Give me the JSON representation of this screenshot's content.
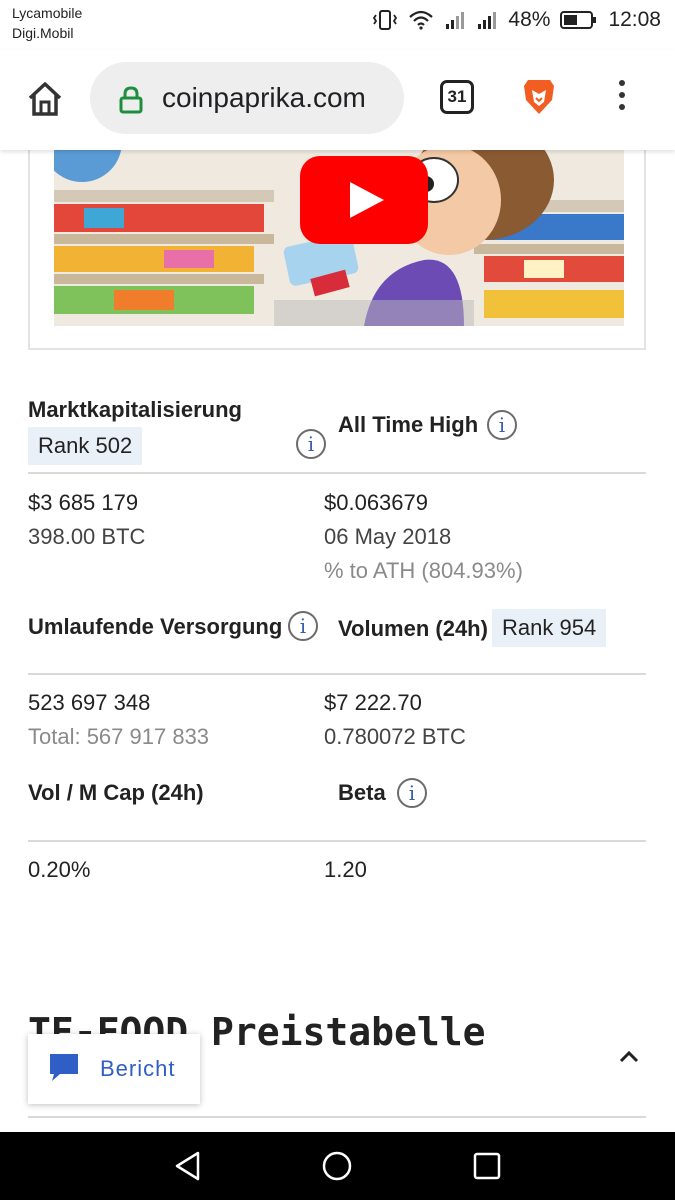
{
  "status_bar": {
    "carrier_1": "Lycamobile",
    "carrier_2": "Digi.Mobil",
    "battery": "48%",
    "time": "12:08"
  },
  "browser": {
    "url": "coinpaprika.com",
    "tab_count": "31"
  },
  "stats": {
    "market_cap": {
      "label": "Marktkapitalisierung",
      "rank": "Rank 502",
      "value": "$3 685 179",
      "btc": "398.00 BTC"
    },
    "ath": {
      "label": "All Time High",
      "value": "$0.063679",
      "date": "06 May 2018",
      "to_ath": "% to ATH (804.93%)"
    },
    "circulating": {
      "label": "Umlaufende Versorgung",
      "value": "523 697 348",
      "total": "Total: 567 917 833"
    },
    "volume": {
      "label": "Volumen (24h)",
      "rank": "Rank 954",
      "value": "$7 222.70",
      "btc": "0.780072 BTC"
    },
    "vol_mcap": {
      "label": "Vol / M Cap (24h)",
      "value": "0.20%"
    },
    "beta": {
      "label": "Beta",
      "value": "1.20"
    }
  },
  "price_table": {
    "title": "TE-FOOD Preistabelle"
  },
  "report_button": {
    "label": "Bericht"
  },
  "colors": {
    "accent_blue": "#2f5fc4",
    "rank_bg": "#e9f0f8",
    "youtube_red": "#ff0000",
    "brave_orange": "#f25d22",
    "lock_green": "#1e8e3e"
  }
}
